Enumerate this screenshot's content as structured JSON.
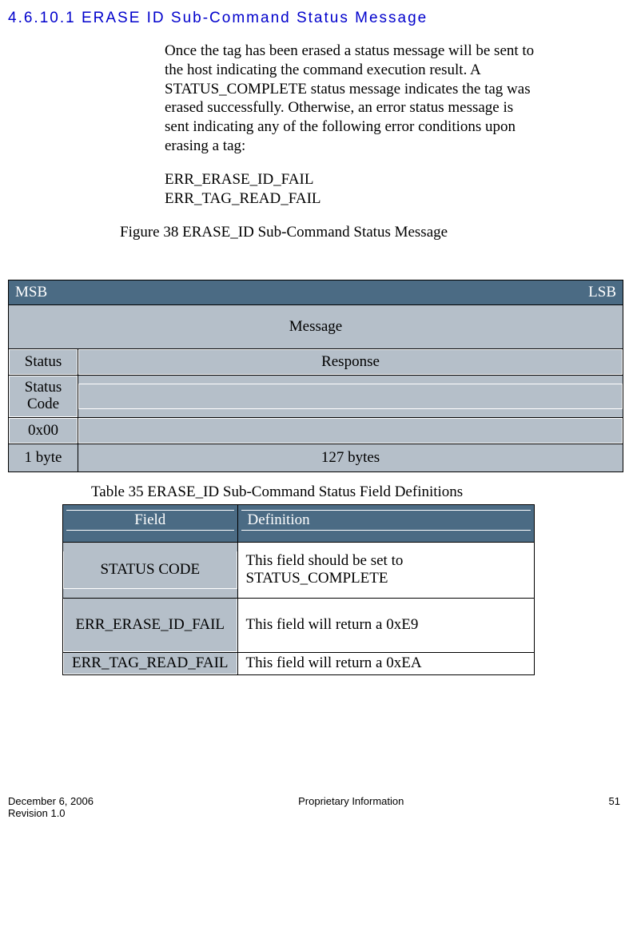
{
  "heading": "4.6.10.1  ERASE ID Sub-Command Status Message",
  "para1": "Once the tag has been erased a status message will be sent to the host indicating the command execution result.  A STATUS_COMPLETE status message indicates the tag was erased successfully.  Otherwise, an error status message is sent indicating any of the following error conditions upon erasing a tag:",
  "errs": {
    "e1": "ERR_ERASE_ID_FAIL",
    "e2": "ERR_TAG_READ_FAIL"
  },
  "figureCaption": "Figure 38 ERASE_ID Sub-Command Status Message",
  "t1": {
    "msb": "MSB",
    "lsb": "LSB",
    "message": "Message",
    "status": "Status",
    "response": "Response",
    "statusCode": "Status Code",
    "val": "0x00",
    "b1": "1 byte",
    "b127": "127 bytes"
  },
  "tableCaption": "Table 35 ERASE_ID Sub-Command Status Field Definitions",
  "t2": {
    "hField": "Field",
    "hDef": "Definition",
    "r1f": "STATUS CODE",
    "r1d": "This field should be set to STATUS_COMPLETE",
    "r2f": "ERR_ERASE_ID_FAIL",
    "r2d": "This field will return a 0xE9",
    "r3f": "ERR_TAG_READ_FAIL",
    "r3d": "This field will return a 0xEA"
  },
  "footer": {
    "date": "December 6, 2006",
    "rev": "Revision 1.0",
    "center": "Proprietary Information",
    "page": "51"
  }
}
